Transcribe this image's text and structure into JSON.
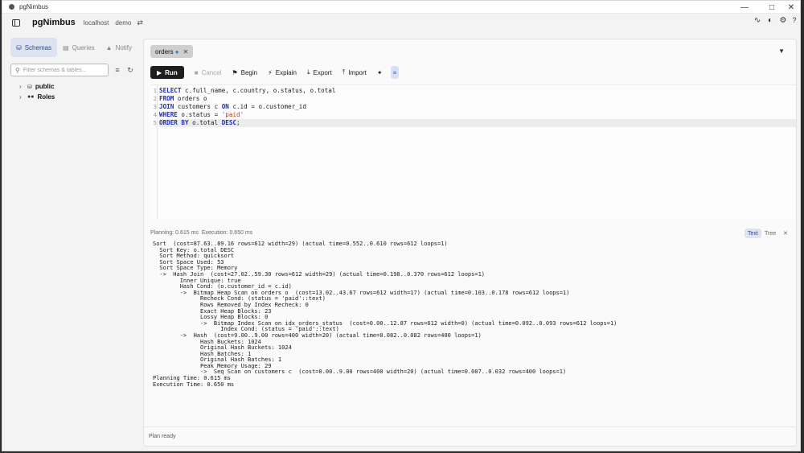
{
  "window": {
    "title": "pgNimbus"
  },
  "header": {
    "brand": "pgNimbus",
    "connection": "localhost",
    "database": "demo"
  },
  "sidebar": {
    "tabs": [
      {
        "label": "Schemas",
        "icon": "database-icon",
        "active": true
      },
      {
        "label": "Queries",
        "icon": "queries-icon",
        "active": false
      },
      {
        "label": "Notify",
        "icon": "bell-icon",
        "active": false
      }
    ],
    "filter_placeholder": "Filter schemas & tables...",
    "tree": [
      {
        "label": "public",
        "icon": "database-icon"
      },
      {
        "label": "Roles",
        "icon": "users-icon"
      }
    ]
  },
  "tabs": [
    {
      "label": "orders",
      "dirty": true
    }
  ],
  "toolbar": {
    "run": "Run",
    "cancel": "Cancel",
    "begin": "Begin",
    "explain": "Explain",
    "export": "Export",
    "import": "Import"
  },
  "editor": {
    "line_numbers": [
      "1",
      "2",
      "3",
      "4",
      "5"
    ],
    "current_line": 5
  },
  "result": {
    "planning": "Planning: 0.615 ms",
    "execution": "Execution: 0.650 ms",
    "view_text": "Text",
    "view_tree": "Tree",
    "plan_lines": [
      "Sort  (cost=87.63..89.16 rows=612 width=29) (actual time=0.552..0.610 rows=612 loops=1)",
      "  Sort Key: o.total DESC",
      "  Sort Method: quicksort",
      "  Sort Space Used: 53",
      "  Sort Space Type: Memory",
      "  ->  Hash Join  (cost=27.02..59.30 rows=612 width=29) (actual time=0.198..0.370 rows=612 loops=1)",
      "        Inner Unique: true",
      "        Hash Cond: (o.customer_id = c.id)",
      "        ->  Bitmap Heap Scan on orders o  (cost=13.02..43.67 rows=612 width=17) (actual time=0.103..0.178 rows=612 loops=1)",
      "              Recheck Cond: (status = 'paid'::text)",
      "              Rows Removed by Index Recheck: 0",
      "              Exact Heap Blocks: 23",
      "              Lossy Heap Blocks: 0",
      "              ->  Bitmap Index Scan on idx_orders_status  (cost=0.00..12.87 rows=612 width=0) (actual time=0.092..0.093 rows=612 loops=1)",
      "                    Index Cond: (status = 'paid'::text)",
      "        ->  Hash  (cost=9.00..9.00 rows=400 width=20) (actual time=0.082..0.082 rows=400 loops=1)",
      "              Hash Buckets: 1024",
      "              Original Hash Buckets: 1024",
      "              Hash Batches: 1",
      "              Original Hash Batches: 1",
      "              Peak Memory Usage: 29",
      "              ->  Seq Scan on customers c  (cost=0.00..9.00 rows=400 width=20) (actual time=0.007..0.032 rows=400 loops=1)",
      "Planning Time: 0.615 ms",
      "Execution Time: 0.650 ms"
    ]
  },
  "status": {
    "text": "Plan ready"
  },
  "colors": {
    "accent": "#4a78c9",
    "run_bg": "#1e1e1e",
    "keyword": "#1f2fb5",
    "string": "#b5451f"
  }
}
